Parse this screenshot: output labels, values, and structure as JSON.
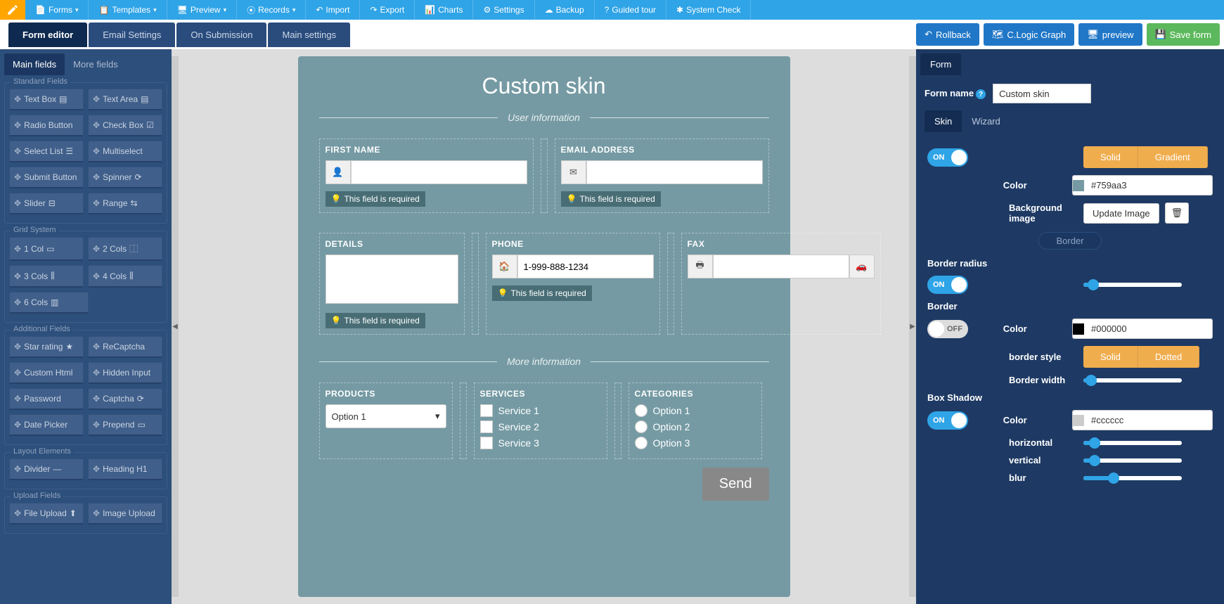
{
  "topbar": {
    "items": [
      "Forms",
      "Templates",
      "Preview",
      "Records",
      "Import",
      "Export",
      "Charts",
      "Settings",
      "Backup",
      "Guided tour",
      "System Check"
    ]
  },
  "tabs": {
    "items": [
      "Form editor",
      "Email Settings",
      "On Submission",
      "Main settings"
    ],
    "active": 0,
    "rollback": "Rollback",
    "clogic": "C.Logic Graph",
    "preview": "preview",
    "save": "Save form"
  },
  "palette": {
    "tabs": [
      "Main fields",
      "More fields"
    ],
    "groups": [
      {
        "title": "Standard Fields",
        "items": [
          "Text Box",
          "Text Area",
          "Radio Button",
          "Check Box",
          "Select List",
          "Multiselect",
          "Submit Button",
          "Spinner",
          "Slider",
          "Range"
        ]
      },
      {
        "title": "Grid System",
        "items": [
          "1 Col",
          "2 Cols",
          "3 Cols",
          "4 Cols",
          "6 Cols"
        ]
      },
      {
        "title": "Additional Fields",
        "items": [
          "Star rating",
          "ReCaptcha",
          "Custom Html",
          "Hidden Input",
          "Password",
          "Captcha",
          "Date Picker",
          "Prepend"
        ]
      },
      {
        "title": "Layout Elements",
        "items": [
          "Divider",
          "Heading H1"
        ]
      },
      {
        "title": "Upload Fields",
        "items": [
          "File Upload",
          "Image Upload"
        ]
      }
    ]
  },
  "form": {
    "title": "Custom skin",
    "section1": "User information",
    "section2": "More information",
    "first_name": "FIRST NAME",
    "email": "EMAIL ADDRESS",
    "details": "DETAILS",
    "phone": "PHONE",
    "phone_val": "1-999-888-1234",
    "fax": "FAX",
    "products": "PRODUCTS",
    "products_val": "Option 1",
    "services": "SERVICES",
    "service_opts": [
      "Service 1",
      "Service 2",
      "Service 3"
    ],
    "categories": "CATEGORIES",
    "cat_opts": [
      "Option 1",
      "Option 2",
      "Option 3"
    ],
    "required": "This field is required",
    "send": "Send"
  },
  "right": {
    "tab": "Form",
    "form_name_label": "Form name",
    "form_name_val": "Custom skin",
    "skin_tab": "Skin",
    "wizard_tab": "Wizard",
    "solid": "Solid",
    "gradient": "Gradient",
    "color_label": "Color",
    "color_val": "#759aa3",
    "bgimg_label": "Background image",
    "update_img": "Update Image",
    "border_section": "Border",
    "border_radius": "Border radius",
    "on": "ON",
    "off": "OFF",
    "border_label": "Border",
    "border_color": "#000000",
    "border_style": "border style",
    "dotted": "Dotted",
    "border_width": "Border width",
    "box_shadow": "Box Shadow",
    "shadow_color": "#cccccc",
    "horizontal": "horizontal",
    "vertical": "vertical",
    "blur": "blur"
  }
}
